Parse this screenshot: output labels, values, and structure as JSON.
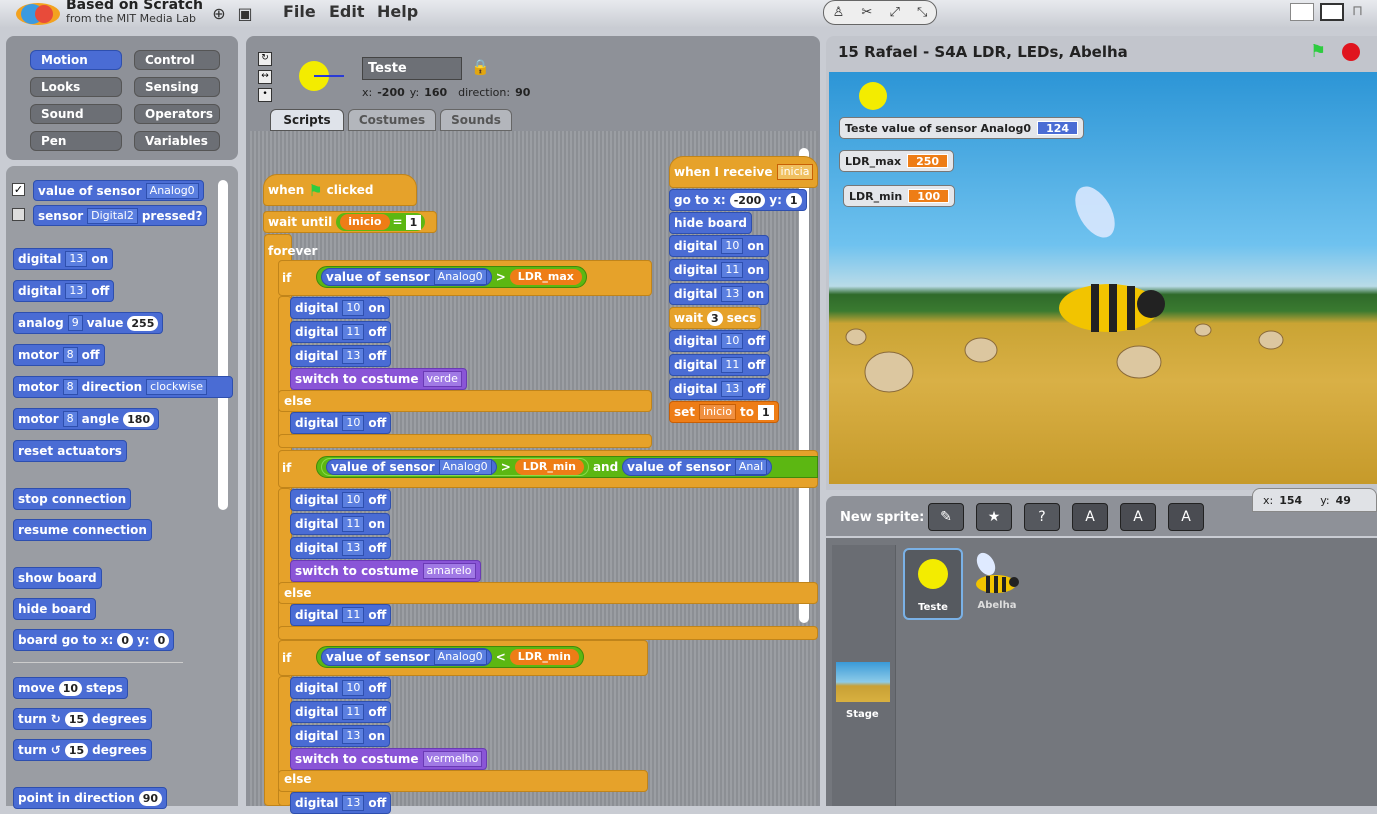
{
  "header": {
    "logo_title": "Based on Scratch",
    "logo_sub": "from the MIT Media Lab",
    "menus": [
      "File",
      "Edit",
      "Help"
    ]
  },
  "categories": [
    "Motion",
    "Control",
    "Looks",
    "Sensing",
    "Sound",
    "Operators",
    "Pen",
    "Variables"
  ],
  "palette": {
    "b1": "value of sensor",
    "b1dd": "Analog0",
    "b2": "sensor",
    "b2dd": "Digital2",
    "b2b": "pressed?",
    "digital": "digital",
    "on": "on",
    "off": "off",
    "n13": "13",
    "analog": "analog",
    "n9": "9",
    "value": "value",
    "n255": "255",
    "motor": "motor",
    "n8": "8",
    "direction": "direction",
    "clockwise": "clockwise",
    "angle": "angle",
    "n180": "180",
    "reset": "reset actuators",
    "stop": "stop connection",
    "resume": "resume connection",
    "show": "show board",
    "hide": "hide board",
    "goto": "board go to x:",
    "y": "y:",
    "zero": "0",
    "move": "move",
    "n10": "10",
    "steps": "steps",
    "turn": "turn",
    "n15": "15",
    "degrees": "degrees",
    "point": "point in direction",
    "n90": "90"
  },
  "sprite": {
    "name": "Teste",
    "x_label": "x:",
    "x": "-200",
    "y_label": "y:",
    "y": "160",
    "dir_label": "direction:",
    "dir": "90"
  },
  "tabs": [
    "Scripts",
    "Costumes",
    "Sounds"
  ],
  "script": {
    "when": "when",
    "clicked": "clicked",
    "wait_until": "wait until",
    "inicio": "inicio",
    "eq": "=",
    "one": "1",
    "forever": "forever",
    "if": "if",
    "else": "else",
    "value_of_sensor": "value of sensor",
    "Analog0": "Analog0",
    "gt": ">",
    "lt": "<",
    "LDR_max": "LDR_max",
    "LDR_min": "LDR_min",
    "and": "and",
    "Anal": "Anal",
    "digital": "digital",
    "on": "on",
    "off": "off",
    "n10": "10",
    "n11": "11",
    "n13": "13",
    "switch": "switch to costume",
    "verde": "verde",
    "amarelo": "amarelo",
    "vermelho": "vermelho",
    "when_receive": "when I receive",
    "inicia": "inicia",
    "goto": "go to x:",
    "gx": "-200",
    "gy": "y:",
    "g3": "1",
    "hide": "hide board",
    "wait": "wait",
    "n3": "3",
    "secs": "secs",
    "set": "set",
    "to": "to"
  },
  "stage": {
    "title": "15 Rafael - S4A LDR, LEDs, Abelha",
    "m1": "Teste value of sensor Analog0",
    "m1v": "124",
    "m2": "LDR_max",
    "m2v": "250",
    "m3": "LDR_min",
    "m3v": "100",
    "xl": "x:",
    "x": "154",
    "yl": "y:",
    "y": "49"
  },
  "sprites": {
    "new": "New sprite:",
    "s1": "Teste",
    "s2": "Abelha",
    "stage": "Stage"
  }
}
